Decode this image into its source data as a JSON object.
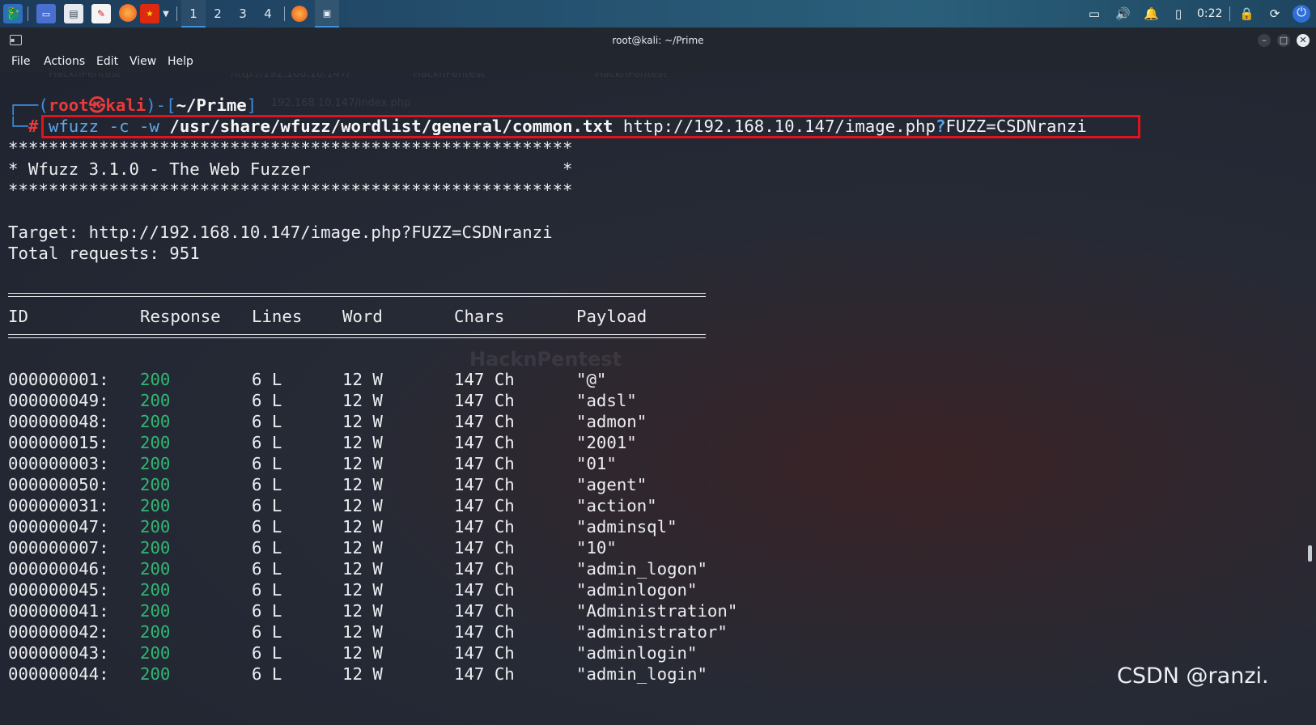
{
  "taskbar": {
    "workspaces": [
      "1",
      "2",
      "3",
      "4"
    ],
    "active_workspace": 0,
    "clock": "0:22",
    "icons": [
      "kali-menu-icon",
      "desktop-icon",
      "file-manager-icon",
      "text-editor-icon",
      "firefox-icon",
      "flag-icon",
      "chevron-down-icon"
    ],
    "tray_icons": [
      "display-icon",
      "volume-icon",
      "bell-icon",
      "battery-icon",
      "lock-icon",
      "refresh-icon",
      "power-icon"
    ]
  },
  "window": {
    "title": "root@kali: ~/Prime",
    "menu": [
      "File",
      "Actions",
      "Edit",
      "View",
      "Help"
    ]
  },
  "terminal": {
    "prompt": {
      "user": "root",
      "at": "㉿",
      "host": "kali",
      "dir": "~/Prime",
      "symbol": "#"
    },
    "command": {
      "tool": "wfuzz",
      "flags": "-c -w",
      "wordlist": "/usr/share/wfuzz/wordlist/general/common.txt",
      "url_pre": "http://192.168.10.147/image.php",
      "url_q": "?",
      "url_post": "FUZZ=CSDNranzi"
    },
    "banner_stars": "********************************************************",
    "banner_title": "* Wfuzz 3.1.0 - The Web Fuzzer                         *",
    "target": "Target: http://192.168.10.147/image.php?FUZZ=CSDNranzi",
    "total": "Total requests: 951",
    "headers": [
      "ID",
      "Response",
      "Lines",
      "Word",
      "Chars",
      "Payload"
    ],
    "rows": [
      [
        "000000001:",
        "200",
        "6 L",
        "12 W",
        "147 Ch",
        "\"@\""
      ],
      [
        "000000049:",
        "200",
        "6 L",
        "12 W",
        "147 Ch",
        "\"adsl\""
      ],
      [
        "000000048:",
        "200",
        "6 L",
        "12 W",
        "147 Ch",
        "\"admon\""
      ],
      [
        "000000015:",
        "200",
        "6 L",
        "12 W",
        "147 Ch",
        "\"2001\""
      ],
      [
        "000000003:",
        "200",
        "6 L",
        "12 W",
        "147 Ch",
        "\"01\""
      ],
      [
        "000000050:",
        "200",
        "6 L",
        "12 W",
        "147 Ch",
        "\"agent\""
      ],
      [
        "000000031:",
        "200",
        "6 L",
        "12 W",
        "147 Ch",
        "\"action\""
      ],
      [
        "000000047:",
        "200",
        "6 L",
        "12 W",
        "147 Ch",
        "\"adminsql\""
      ],
      [
        "000000007:",
        "200",
        "6 L",
        "12 W",
        "147 Ch",
        "\"10\""
      ],
      [
        "000000046:",
        "200",
        "6 L",
        "12 W",
        "147 Ch",
        "\"admin_logon\""
      ],
      [
        "000000045:",
        "200",
        "6 L",
        "12 W",
        "147 Ch",
        "\"adminlogon\""
      ],
      [
        "000000041:",
        "200",
        "6 L",
        "12 W",
        "147 Ch",
        "\"Administration\""
      ],
      [
        "000000042:",
        "200",
        "6 L",
        "12 W",
        "147 Ch",
        "\"administrator\""
      ],
      [
        "000000043:",
        "200",
        "6 L",
        "12 W",
        "147 Ch",
        "\"adminlogin\""
      ],
      [
        "000000044:",
        "200",
        "6 L",
        "12 W",
        "147 Ch",
        "\"admin_login\""
      ]
    ],
    "ghost_text": [
      "HacknPentest",
      "http://192.168.10.147/",
      "HacknPentest",
      "HacknPentest",
      "192.168.10.147/index.php",
      "HacknPentest"
    ]
  },
  "watermark": "CSDN @ranzi.",
  "colors": {
    "accent": "#3b93e0",
    "highlight": "#e0141e",
    "status_ok": "#2fb872"
  }
}
